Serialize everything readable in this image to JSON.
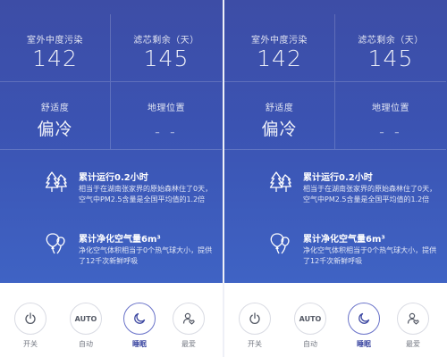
{
  "metrics": [
    {
      "label": "室外中度污染",
      "value": "142"
    },
    {
      "label": "滤芯剩余（天）",
      "value": "145"
    },
    {
      "label": "舒适度",
      "value": "偏冷"
    },
    {
      "label": "地理位置",
      "value": "- -"
    }
  ],
  "stats": [
    {
      "icon": "forest-trees-icon",
      "title": "累计运行0.2小时",
      "description": "相当于在湖南张家界的原始森林住了0天，空气中PM2.5含量是全国平均值的1.2倍"
    },
    {
      "icon": "balloons-icon",
      "title": "累计净化空气量6m³",
      "description": "净化空气体积相当于0个热气球大小，提供了12千次新鲜呼吸"
    }
  ],
  "modes": [
    {
      "icon": "power-icon",
      "label": "开关",
      "text": ""
    },
    {
      "icon": "auto-icon",
      "label": "自动",
      "text": "AUTO"
    },
    {
      "icon": "moon-icon",
      "label": "睡眠",
      "text": "",
      "active": true
    },
    {
      "icon": "favorite-user-icon",
      "label": "最爱",
      "text": ""
    }
  ],
  "colors": {
    "background_top": "#3d4da6",
    "background_bottom": "#3f63c4",
    "accent": "#3f4aa3"
  }
}
